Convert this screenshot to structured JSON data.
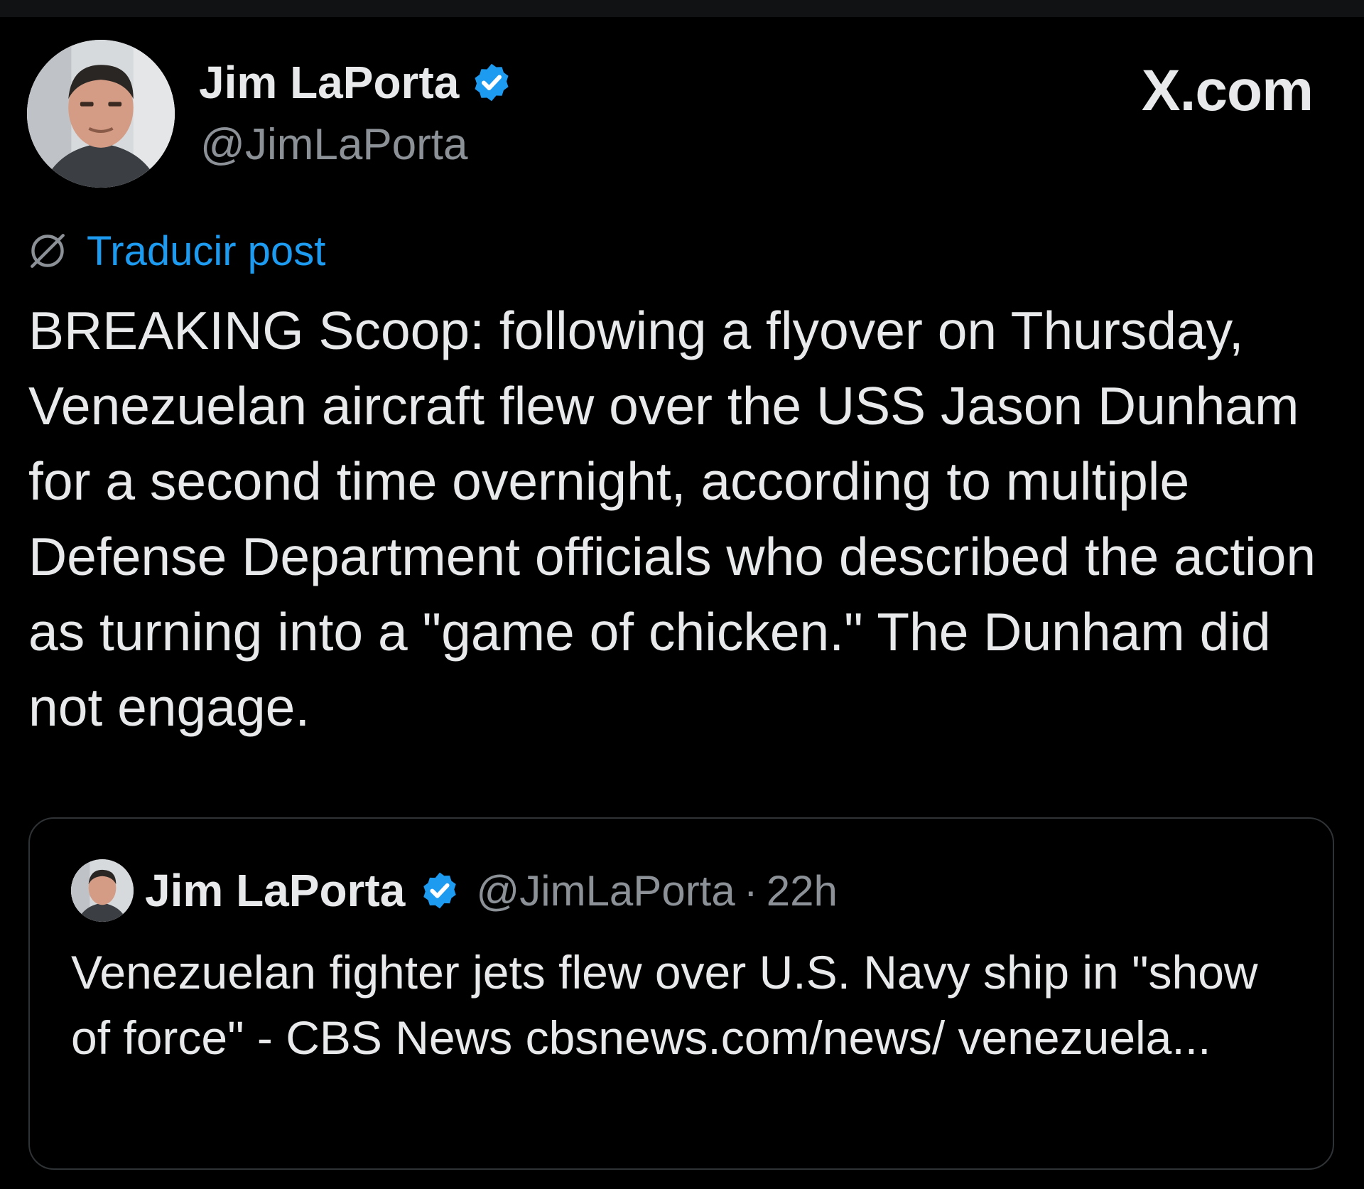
{
  "author": {
    "display_name": "Jim LaPorta",
    "handle": "@JimLaPorta",
    "verified": true
  },
  "brand": "X.com",
  "translate": {
    "label": "Traducir post"
  },
  "post": {
    "text": "BREAKING Scoop: following a flyover on Thursday, Venezuelan aircraft flew over the USS Jason Dunham for a second time overnight, according to multiple Defense Department officials who described the action as turning into a \"game of chicken.\" The Dunham did not engage."
  },
  "quoted_post": {
    "display_name": "Jim LaPorta",
    "handle": "@JimLaPorta",
    "separator": "·",
    "time": "22h",
    "text": "Venezuelan fighter jets flew over U.S. Navy ship in \"show of force\" - CBS News cbsnews.com/news/ venezuela..."
  },
  "colors": {
    "background": "#000000",
    "text": "#e7e9ea",
    "muted": "#8b9196",
    "link": "#1d9bf0",
    "border": "#2f3336",
    "verified": "#1d9bf0"
  },
  "icons": {
    "verified": "verified-badge-icon",
    "translate": "globe-icon"
  }
}
